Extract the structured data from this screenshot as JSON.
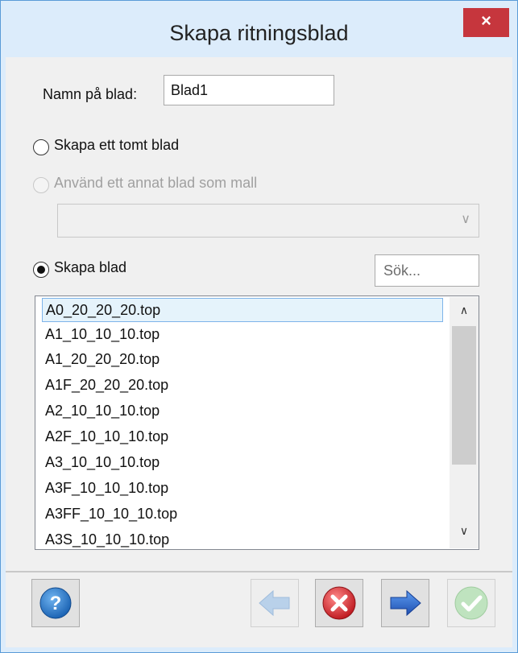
{
  "window": {
    "title": "Skapa ritningsblad",
    "close_glyph": "×"
  },
  "name_field": {
    "label": "Namn på blad:",
    "value": "Blad1"
  },
  "options": {
    "empty": {
      "label": "Skapa ett tomt blad",
      "selected": false
    },
    "template": {
      "label": "Använd ett annat blad som mall",
      "selected": false,
      "enabled": false
    },
    "create": {
      "label": "Skapa blad",
      "selected": true
    }
  },
  "template_select": {
    "value": ""
  },
  "search": {
    "placeholder": "Sök..."
  },
  "list": {
    "items": [
      "A0_20_20_20.top",
      "A1_10_10_10.top",
      "A1_20_20_20.top",
      "A1F_20_20_20.top",
      "A2_10_10_10.top",
      "A2F_10_10_10.top",
      "A3_10_10_10.top",
      "A3F_10_10_10.top",
      "A3FF_10_10_10.top",
      "A3S_10_10_10.top"
    ],
    "selected_index": 0
  },
  "buttons": {
    "help": {
      "icon": "help-icon",
      "color": "#1c64b4"
    },
    "back": {
      "icon": "arrow-left-icon",
      "enabled": false
    },
    "cancel": {
      "icon": "cancel-icon",
      "color": "#d0262c"
    },
    "next": {
      "icon": "arrow-right-icon",
      "color": "#2a64c8"
    },
    "finish": {
      "icon": "check-icon",
      "enabled": false
    }
  }
}
